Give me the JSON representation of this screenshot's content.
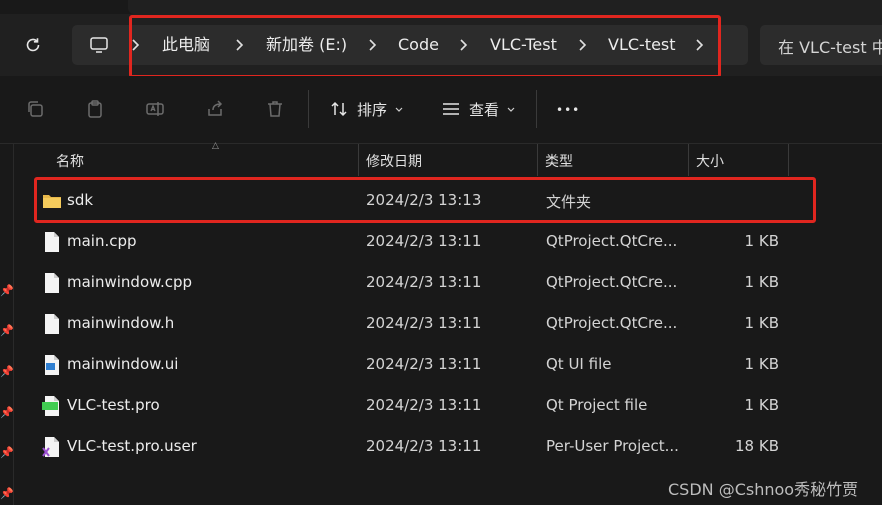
{
  "address": {
    "crumbs": [
      "此电脑",
      "新加卷 (E:)",
      "Code",
      "VLC-Test",
      "VLC-test"
    ],
    "search_placeholder": "在 VLC-test 中"
  },
  "toolbar": {
    "sort_label": "排序",
    "view_label": "查看",
    "more_label": "•••"
  },
  "columns": {
    "name": "名称",
    "modified": "修改日期",
    "type": "类型",
    "size": "大小"
  },
  "files": [
    {
      "name": "sdk",
      "modified": "2024/2/3 13:13",
      "type": "文件夹",
      "size": "",
      "icon": "folder-icon"
    },
    {
      "name": "main.cpp",
      "modified": "2024/2/3 13:11",
      "type": "QtProject.QtCre...",
      "size": "1 KB",
      "icon": "file-icon"
    },
    {
      "name": "mainwindow.cpp",
      "modified": "2024/2/3 13:11",
      "type": "QtProject.QtCre...",
      "size": "1 KB",
      "icon": "file-icon"
    },
    {
      "name": "mainwindow.h",
      "modified": "2024/2/3 13:11",
      "type": "QtProject.QtCre...",
      "size": "1 KB",
      "icon": "file-icon"
    },
    {
      "name": "mainwindow.ui",
      "modified": "2024/2/3 13:11",
      "type": "Qt UI file",
      "size": "1 KB",
      "icon": "ui-file-icon"
    },
    {
      "name": "VLC-test.pro",
      "modified": "2024/2/3 13:11",
      "type": "Qt Project file",
      "size": "1 KB",
      "icon": "pro-file-icon"
    },
    {
      "name": "VLC-test.pro.user",
      "modified": "2024/2/3 13:11",
      "type": "Per-User Project...",
      "size": "18 KB",
      "icon": "user-file-icon"
    }
  ],
  "watermark": "CSDN @Cshnoo秀秘竹贾",
  "colors": {
    "highlight": "#e0261f",
    "folder": "#e8b84a",
    "background": "#191919"
  }
}
